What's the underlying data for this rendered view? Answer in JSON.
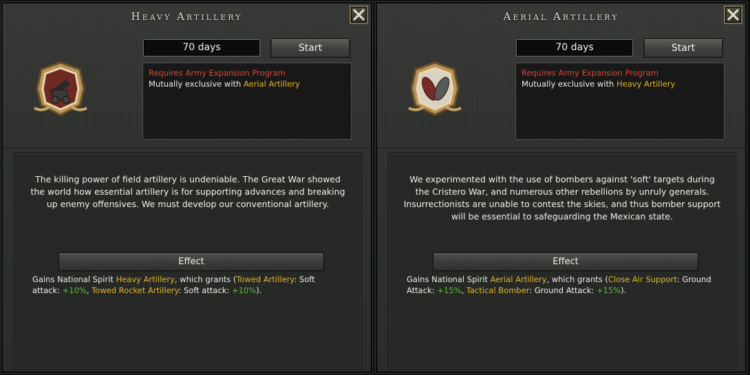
{
  "panels": [
    {
      "title": "Heavy Artillery",
      "days": "70 days",
      "start_label": "Start",
      "requires": "Requires Army Expansion Program",
      "exclusive_prefix": "Mutually exclusive with ",
      "exclusive_with": "Aerial Artillery",
      "description": "The killing power of field artillery is undeniable. The Great War showed the world how essential artillery is for supporting advances and breaking up enemy offensives. We must develop our conventional artillery.",
      "effect_label": "Effect",
      "effect": {
        "t1": "Gains National Spirit ",
        "spirit": "Heavy Artillery",
        "t2": ", which grants (",
        "k1": "Towed Artillery",
        "t3": ": Soft attack: ",
        "v1": "+10%",
        "t4": ", ",
        "k2": "Towed Rocket Artillery",
        "t5": ": Soft attack: ",
        "v2": "+10%",
        "t6": ")."
      },
      "icon": "howitzer-emblem-icon"
    },
    {
      "title": "Aerial Artillery",
      "days": "70 days",
      "start_label": "Start",
      "requires": "Requires Army Expansion Program",
      "exclusive_prefix": "Mutually exclusive with ",
      "exclusive_with": "Heavy Artillery",
      "description": "We experimented with the use of bombers against 'soft' targets during the Cristero War, and numerous other rebellions by unruly generals. Insurrectionists are unable to contest the skies, and thus bomber support will be essential to safeguarding the Mexican state.",
      "effect_label": "Effect",
      "effect": {
        "t1": "Gains National Spirit ",
        "spirit": "Aerial Artillery",
        "t2": ", which grants (",
        "k1": "Close Air Support",
        "t3": ": Ground Attack: ",
        "v1": "+15%",
        "t4": ", ",
        "k2": "Tactical Bomber",
        "t5": ": Ground Attack: ",
        "v2": "+15%",
        "t6": ")."
      },
      "icon": "bombs-emblem-icon"
    }
  ],
  "colors": {
    "requirement": "#d8483c",
    "highlight": "#e3b52c",
    "bonus": "#5dbb3c"
  }
}
